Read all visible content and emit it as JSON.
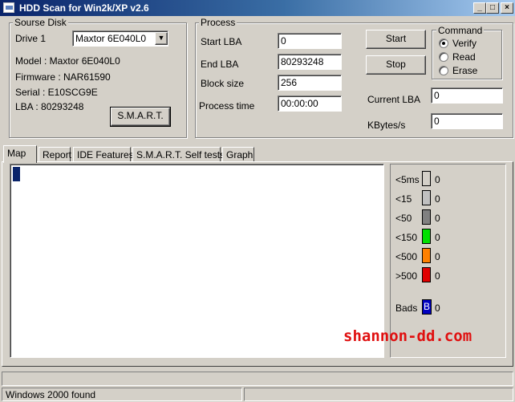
{
  "window": {
    "title": "HDD Scan for Win2k/XP  v2.6",
    "minimize_glyph": "_",
    "maximize_glyph": "□",
    "close_glyph": "×"
  },
  "source_disk": {
    "legend": "Sourse Disk",
    "drive_label": "Drive  1",
    "drive_selected": "Maxtor 6E040L0",
    "model": "Model : Maxtor 6E040L0",
    "firmware": "Firmware : NAR61590",
    "serial": "Serial : E10SCG9E",
    "lba": "LBA :  80293248",
    "smart_button": "S.M.A.R.T."
  },
  "process": {
    "legend": "Process",
    "start_lba_label": "Start LBA",
    "start_lba_value": "0",
    "end_lba_label": "End LBA",
    "end_lba_value": "80293248",
    "block_size_label": "Block size",
    "block_size_value": "256",
    "process_time_label": "Process time",
    "process_time_value": "00:00:00",
    "start_button": "Start",
    "stop_button": "Stop",
    "current_lba_label": "Current LBA",
    "current_lba_value": "0",
    "kbytes_label": "KBytes/s",
    "kbytes_value": "0"
  },
  "command": {
    "legend": "Command",
    "options": [
      "Verify",
      "Read",
      "Erase"
    ],
    "selected": "Verify"
  },
  "tabs": [
    "Map",
    "Report",
    "IDE Features",
    "S.M.A.R.T. Self tests",
    "Graph"
  ],
  "active_tab": "Map",
  "legend_panel": {
    "rows": [
      {
        "label": "<5ms",
        "count": "0",
        "color": "#d4d0c8"
      },
      {
        "label": "<15",
        "count": "0",
        "color": "#c0c0c0"
      },
      {
        "label": "<50",
        "count": "0",
        "color": "#808080"
      },
      {
        "label": "<150",
        "count": "0",
        "color": "#00e000"
      },
      {
        "label": "<500",
        "count": "0",
        "color": "#ff8000"
      },
      {
        "label": ">500",
        "count": "0",
        "color": "#e00000"
      }
    ],
    "bads_label": "Bads",
    "bads_glyph": "B",
    "bads_count": "0",
    "bads_color": "#0000c0"
  },
  "map": {
    "cursor_color": "#0a246a"
  },
  "watermark": "shannon-dd.com",
  "status": {
    "message": "Windows 2000 found"
  }
}
